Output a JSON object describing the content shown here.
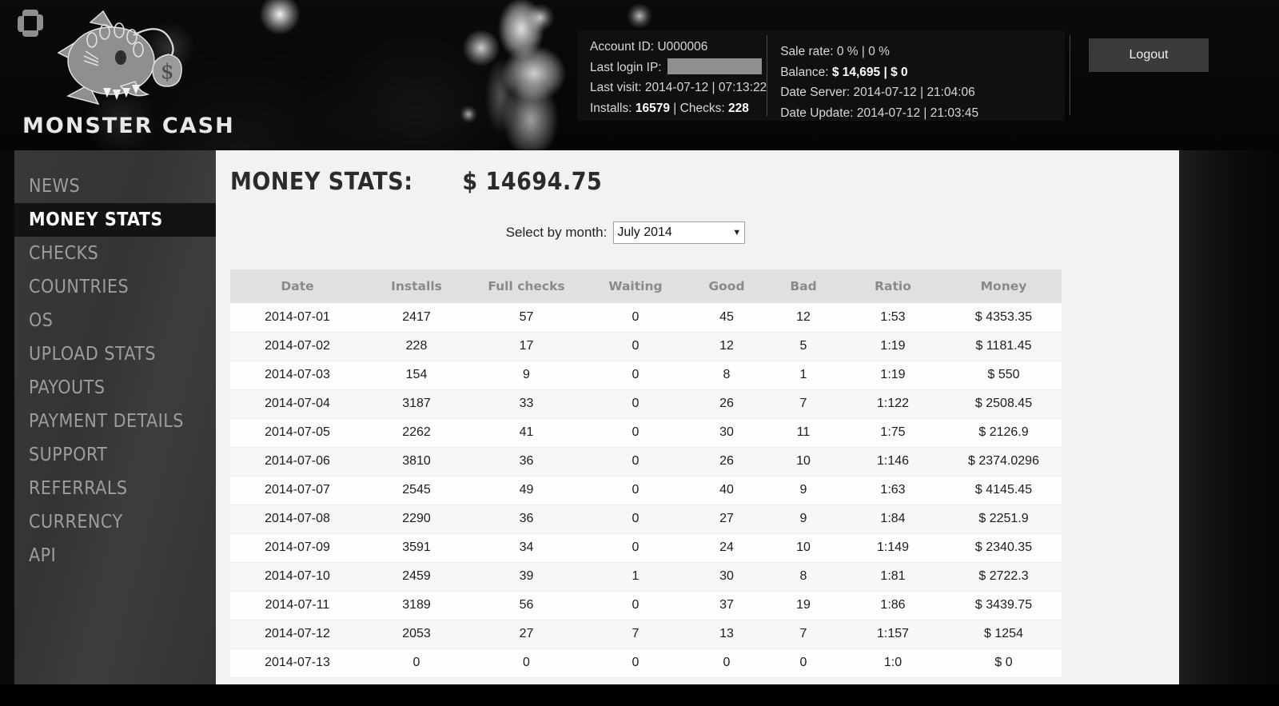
{
  "brand": {
    "logo_text": "MONSTER CASH",
    "mark_icon": "pinwheel-logo-icon",
    "fish_icon": "anglerfish-logo-icon"
  },
  "header": {
    "account_id_label": "Account ID:",
    "account_id_value": "U000006",
    "last_login_ip_label": "Last login IP:",
    "last_login_ip_value": "",
    "last_visit_label": "Last visit:",
    "last_visit_value": "2014-07-12 | 07:13:22",
    "installs_label": "Installs:",
    "installs_value": "16579",
    "checks_label": "Checks:",
    "checks_value": "228",
    "sale_rate_label": "Sale rate:",
    "sale_rate_value": "0 % | 0 %",
    "balance_label": "Balance:",
    "balance_value": "$ 14,695 | $ 0",
    "date_server_label": "Date Server:",
    "date_server_value": "2014-07-12 | 21:04:06",
    "date_update_label": "Date Update:",
    "date_update_value": "2014-07-12 | 21:03:45",
    "logout_label": "Logout"
  },
  "sidebar": {
    "items": [
      {
        "label": "NEWS",
        "active": false
      },
      {
        "label": "MONEY STATS",
        "active": true
      },
      {
        "label": "CHECKS",
        "active": false
      },
      {
        "label": "COUNTRIES",
        "active": false
      },
      {
        "label": "OS",
        "active": false
      },
      {
        "label": "UPLOAD STATS",
        "active": false
      },
      {
        "label": "PAYOUTS",
        "active": false
      },
      {
        "label": "PAYMENT DETAILS",
        "active": false
      },
      {
        "label": "SUPPORT",
        "active": false
      },
      {
        "label": "REFERRALS",
        "active": false
      },
      {
        "label": "CURRENCY",
        "active": false
      },
      {
        "label": "API",
        "active": false
      }
    ]
  },
  "main": {
    "title": "MONEY STATS:",
    "total_amount": "$ 14694.75",
    "month_filter_label": "Select by month:",
    "month_selected": "July 2014",
    "caret_icon": "chevron-down-icon",
    "columns": [
      "Date",
      "Installs",
      "Full checks",
      "Waiting",
      "Good",
      "Bad",
      "Ratio",
      "Money"
    ],
    "rows": [
      [
        "2014-07-01",
        "2417",
        "57",
        "0",
        "45",
        "12",
        "1:53",
        "$ 4353.35"
      ],
      [
        "2014-07-02",
        "228",
        "17",
        "0",
        "12",
        "5",
        "1:19",
        "$ 1181.45"
      ],
      [
        "2014-07-03",
        "154",
        "9",
        "0",
        "8",
        "1",
        "1:19",
        "$ 550"
      ],
      [
        "2014-07-04",
        "3187",
        "33",
        "0",
        "26",
        "7",
        "1:122",
        "$ 2508.45"
      ],
      [
        "2014-07-05",
        "2262",
        "41",
        "0",
        "30",
        "11",
        "1:75",
        "$ 2126.9"
      ],
      [
        "2014-07-06",
        "3810",
        "36",
        "0",
        "26",
        "10",
        "1:146",
        "$ 2374.0296"
      ],
      [
        "2014-07-07",
        "2545",
        "49",
        "0",
        "40",
        "9",
        "1:63",
        "$ 4145.45"
      ],
      [
        "2014-07-08",
        "2290",
        "36",
        "0",
        "27",
        "9",
        "1:84",
        "$ 2251.9"
      ],
      [
        "2014-07-09",
        "3591",
        "34",
        "0",
        "24",
        "10",
        "1:149",
        "$ 2340.35"
      ],
      [
        "2014-07-10",
        "2459",
        "39",
        "1",
        "30",
        "8",
        "1:81",
        "$ 2722.3"
      ],
      [
        "2014-07-11",
        "3189",
        "56",
        "0",
        "37",
        "19",
        "1:86",
        "$ 3439.75"
      ],
      [
        "2014-07-12",
        "2053",
        "27",
        "7",
        "13",
        "7",
        "1:157",
        "$ 1254"
      ],
      [
        "2014-07-13",
        "0",
        "0",
        "0",
        "0",
        "0",
        "1:0",
        "$ 0"
      ]
    ]
  }
}
